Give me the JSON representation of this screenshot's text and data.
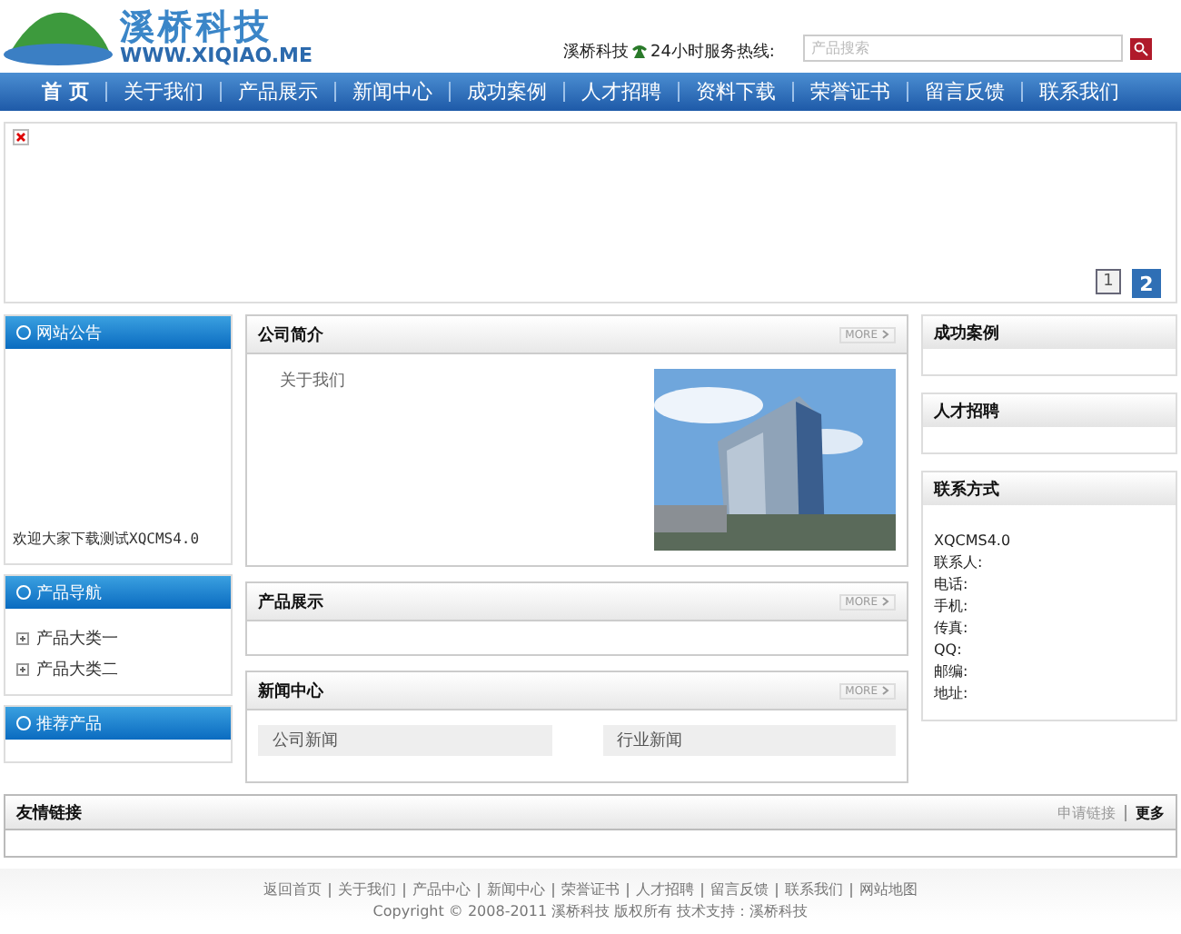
{
  "logo": {
    "name": "溪桥科技",
    "url": "WWW.XIQIAO.ME"
  },
  "hotline": "溪桥科技",
  "hotline_suffix": "24小时服务热线:",
  "search": {
    "placeholder": "产品搜索"
  },
  "nav": [
    {
      "label": "首 页",
      "selected": true
    },
    {
      "label": "关于我们",
      "selected": false
    },
    {
      "label": "产品展示",
      "selected": false
    },
    {
      "label": "新闻中心",
      "selected": false
    },
    {
      "label": "成功案例",
      "selected": false
    },
    {
      "label": "人才招聘",
      "selected": false
    },
    {
      "label": "资料下载",
      "selected": false
    },
    {
      "label": "荣誉证书",
      "selected": false
    },
    {
      "label": "留言反馈",
      "selected": false
    },
    {
      "label": "联系我们",
      "selected": false
    }
  ],
  "banner": {
    "pages": [
      {
        "label": "1",
        "selected": false
      },
      {
        "label": "2",
        "selected": true
      }
    ]
  },
  "left": {
    "notice": {
      "title": "网站公告",
      "text": "欢迎大家下载测试XQCMS4.0"
    },
    "product_nav": {
      "title": "产品导航",
      "items": [
        {
          "label": "产品大类一",
          "expanded": false
        },
        {
          "label": "产品大类二",
          "expanded": false
        }
      ]
    },
    "recommend": {
      "title": "推荐产品"
    }
  },
  "middle": {
    "about": {
      "title": "公司简介",
      "more": "MORE",
      "text": "关于我们"
    },
    "products": {
      "title": "产品展示",
      "more": "MORE"
    },
    "news": {
      "title": "新闻中心",
      "more": "MORE",
      "tabs": [
        "公司新闻",
        "行业新闻"
      ]
    }
  },
  "right": {
    "cases": {
      "title": "成功案例"
    },
    "jobs": {
      "title": "人才招聘"
    },
    "contact": {
      "title": "联系方式",
      "lines": [
        "XQCMS4.0",
        "联系人:",
        "电话:",
        "手机:",
        "传真:",
        "QQ:",
        "邮编:",
        "地址:"
      ]
    }
  },
  "links": {
    "title": "友情链接",
    "actions": [
      "申请链接",
      "更多"
    ]
  },
  "footer": {
    "links": [
      "返回首页",
      "关于我们",
      "产品中心",
      "新闻中心",
      "荣誉证书",
      "人才招聘",
      "留言反馈",
      "联系我们",
      "网站地图"
    ],
    "copyright": "Copyright © 2008-2011 溪桥科技 版权所有 技术支持：溪桥科技"
  }
}
